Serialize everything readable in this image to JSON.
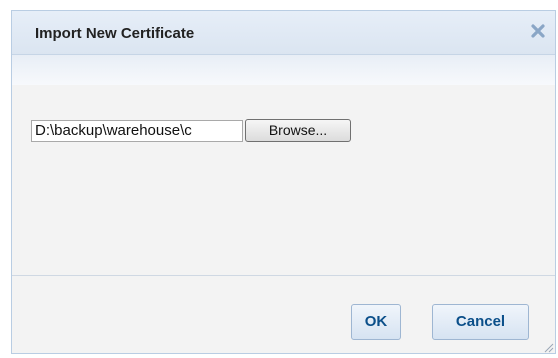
{
  "dialog": {
    "title": "Import New Certificate",
    "close_icon": "close-icon"
  },
  "file_input": {
    "value": "D:\\backup\\warehouse\\c",
    "browse_label": "Browse..."
  },
  "buttons": {
    "ok_label": "OK",
    "cancel_label": "Cancel"
  },
  "colors": {
    "title_bar": "#dbe5f1",
    "border": "#b9cde3",
    "button_text": "#0b4f8a",
    "close_icon": "#8aa6c6"
  }
}
